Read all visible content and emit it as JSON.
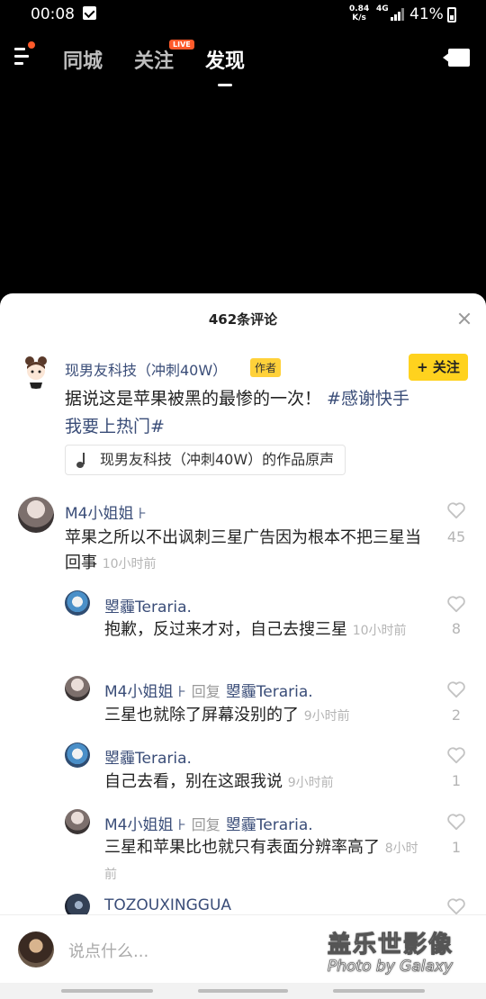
{
  "status_bar": {
    "time": "00:08",
    "net_speed": "0.84",
    "net_unit": "K/s",
    "signal": "4G",
    "battery": "41%"
  },
  "nav": {
    "tabs": [
      "同城",
      "关注",
      "发现"
    ],
    "active": "发现",
    "live_badge": "LIVE"
  },
  "panel": {
    "title": "462条评论",
    "author": {
      "name": "现男友科技（冲刺40W）",
      "tag": "作者",
      "follow_label": "+ 关注",
      "caption_text": "据说这是苹果被黑的最惨的一次！ ",
      "caption_tag": "#感谢快手我要上热门#",
      "music": "现男友科技（冲刺40W）的作品原声"
    },
    "comments": [
      {
        "name": "M4小姐姐 ⊦",
        "text": "苹果之所以不出讽刺三星广告因为根本不把三星当回事",
        "time": "10小时前",
        "likes": "45"
      },
      {
        "name": "曌霾Teraria.",
        "text": "抱歉，反过来才对，自己去搜三星",
        "time": "10小时前",
        "likes": "8"
      },
      {
        "name": "M4小姐姐 ⊦",
        "reply_label": "回复",
        "reply_to": "曌霾Teraria.",
        "text": "三星也就除了屏幕没别的了",
        "time": "9小时前",
        "likes": "2"
      },
      {
        "name": "曌霾Teraria.",
        "text": "自己去看，别在这跟我说",
        "time": "9小时前",
        "likes": "1"
      },
      {
        "name": "M4小姐姐 ⊦",
        "reply_label": "回复",
        "reply_to": "曌霾Teraria.",
        "text": "三星和苹果比也就只有表面分辨率高了",
        "time": "8小时前",
        "likes": "1"
      },
      {
        "name": "TOZOUXINGGUA"
      }
    ],
    "input_placeholder": "说点什么...",
    "watermark_line1": "盖乐世影像",
    "watermark_line2": "Photo by Galaxy"
  }
}
